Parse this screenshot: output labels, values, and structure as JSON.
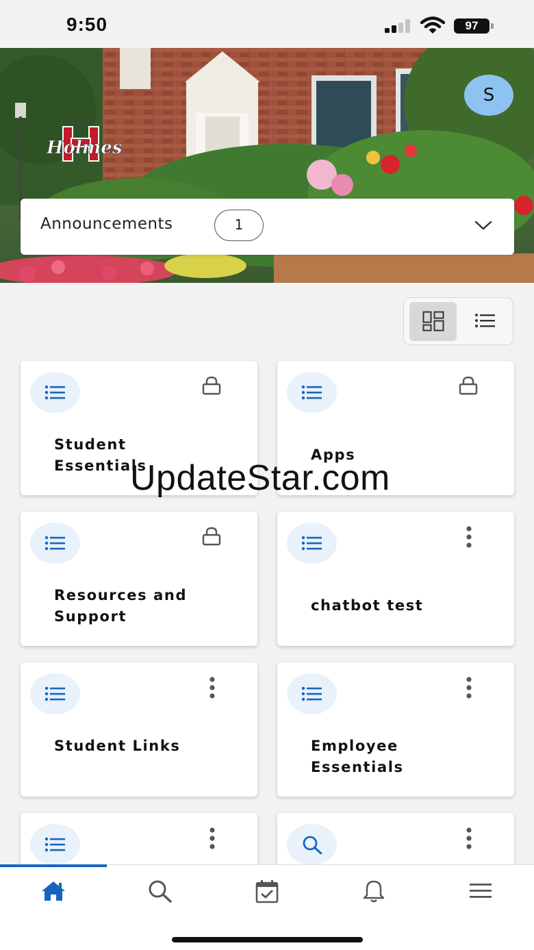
{
  "status_bar": {
    "time": "9:50",
    "battery": "97",
    "icons": [
      "signal-icon",
      "wifi-icon",
      "battery-icon"
    ]
  },
  "header": {
    "logo_text": "Holmes",
    "avatar_initial": "S"
  },
  "announcements": {
    "label": "Announcements",
    "count": "1",
    "expand_icon": "chevron-down-icon"
  },
  "view_toggle": {
    "options": [
      "grid-view-icon",
      "list-view-icon"
    ],
    "selected": "grid"
  },
  "cards": [
    {
      "title": "Student Essentials",
      "icon": "list-icon",
      "action_icon": "lock-icon"
    },
    {
      "title": "Apps",
      "icon": "list-icon",
      "action_icon": "lock-icon"
    },
    {
      "title": "Resources and Support",
      "icon": "list-icon",
      "action_icon": "lock-icon"
    },
    {
      "title": "chatbot test",
      "icon": "list-icon",
      "action_icon": "more-vertical-icon"
    },
    {
      "title": "Student Links",
      "icon": "list-icon",
      "action_icon": "more-vertical-icon"
    },
    {
      "title": "Employee Essentials",
      "icon": "list-icon",
      "action_icon": "more-vertical-icon"
    },
    {
      "title": "",
      "icon": "list-icon",
      "action_icon": "more-vertical-icon"
    },
    {
      "title": "",
      "icon": "search-icon",
      "action_icon": "more-vertical-icon"
    }
  ],
  "watermark": "UpdateStar.com",
  "bottom_nav": {
    "items": [
      "home-icon",
      "search-icon",
      "calendar-check-icon",
      "bell-icon",
      "menu-icon"
    ],
    "active": "home-icon"
  },
  "colors": {
    "accent": "#1565c0",
    "icon_circle": "#e9f1fa",
    "avatar": "#8ec2f0"
  }
}
